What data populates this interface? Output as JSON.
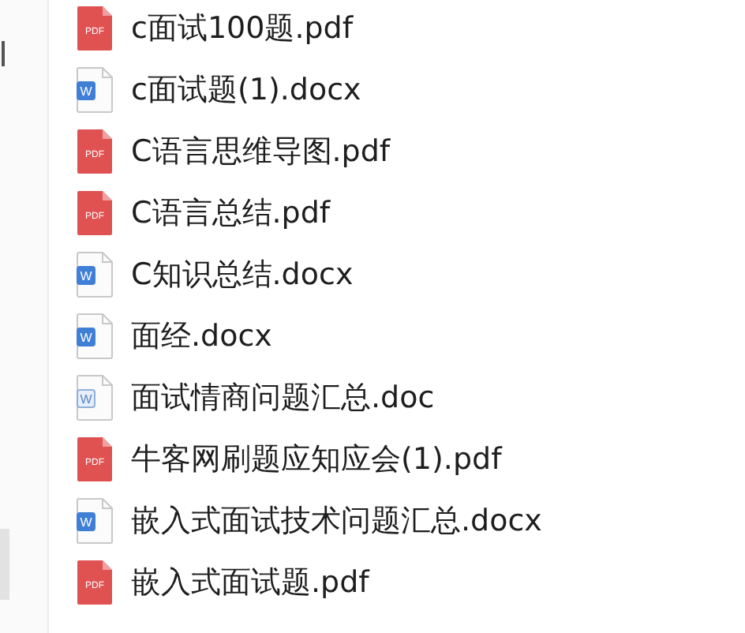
{
  "files": [
    {
      "name": "c面试100题.pdf",
      "kind": "pdf",
      "badge": "PDF"
    },
    {
      "name": "c面试题(1).docx",
      "kind": "docx",
      "badge": "W"
    },
    {
      "name": "C语言思维导图.pdf",
      "kind": "pdf",
      "badge": "PDF"
    },
    {
      "name": "C语言总结.pdf",
      "kind": "pdf",
      "badge": "PDF"
    },
    {
      "name": "C知识总结.docx",
      "kind": "docx",
      "badge": "W"
    },
    {
      "name": "面经.docx",
      "kind": "docx",
      "badge": "W"
    },
    {
      "name": "面试情商问题汇总.doc",
      "kind": "doc",
      "badge": "W"
    },
    {
      "name": "牛客网刷题应知应会(1).pdf",
      "kind": "pdf",
      "badge": "PDF"
    },
    {
      "name": "嵌入式面试技术问题汇总.docx",
      "kind": "docx",
      "badge": "W"
    },
    {
      "name": "嵌入式面试题.pdf",
      "kind": "pdf",
      "badge": "PDF"
    }
  ]
}
